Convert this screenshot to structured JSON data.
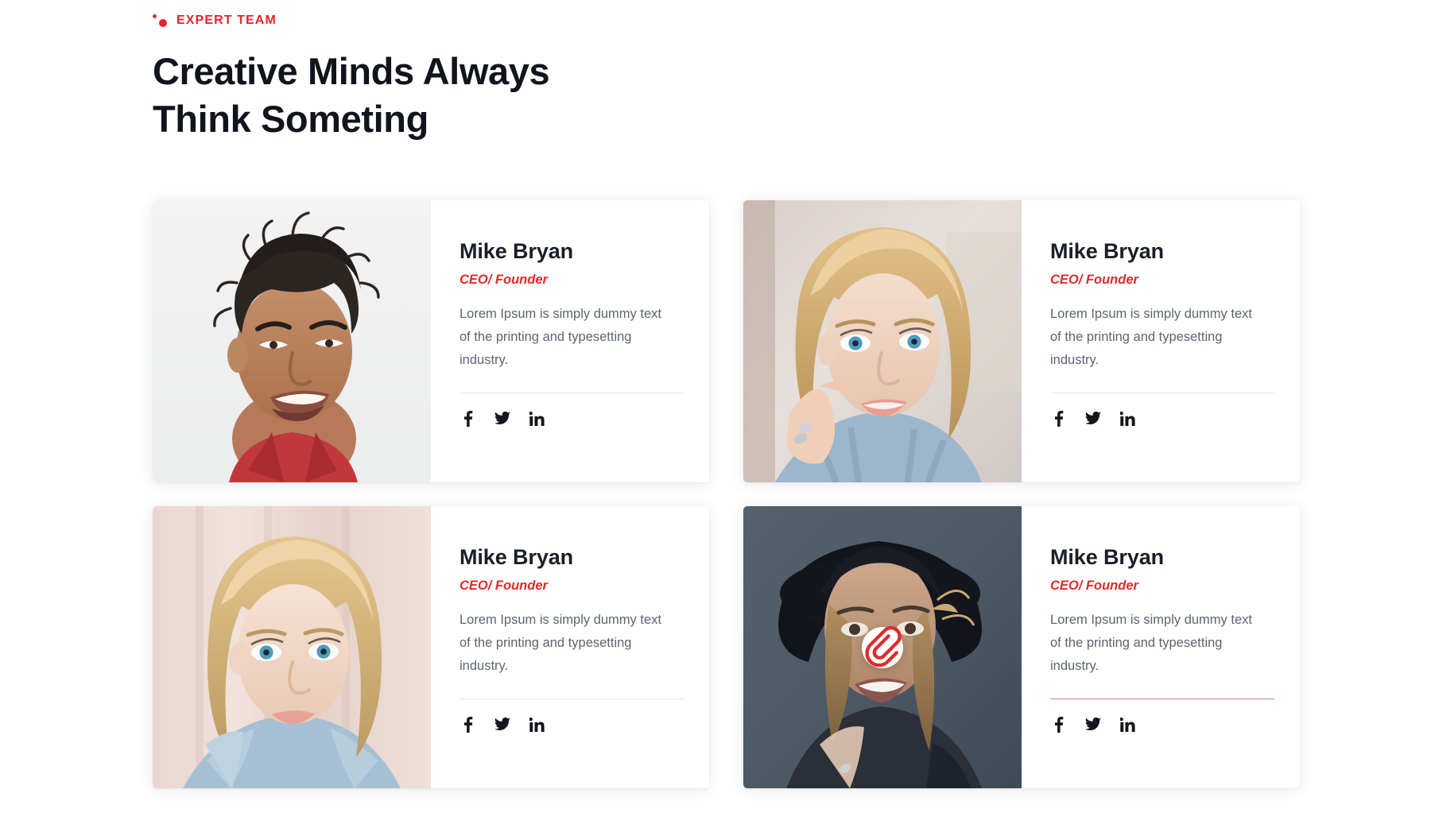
{
  "section": {
    "eyebrow": "EXPERT TEAM",
    "title_line1": "Creative Minds Always",
    "title_line2": "Think Someting",
    "accent_color": "#e8232a",
    "heading_color": "#12141d",
    "body_text_color": "#5d6470"
  },
  "icons": {
    "dot_small": "dot-icon",
    "dot_large": "dot-icon",
    "facebook": "facebook-icon",
    "twitter": "twitter-icon",
    "linkedin": "linkedin-icon",
    "paperclip": "paperclip-icon"
  },
  "social_labels": {
    "facebook": "Facebook",
    "twitter": "Twitter",
    "linkedin": "LinkedIn"
  },
  "cards": [
    {
      "name": "Mike Bryan",
      "role": "CEO/ Founder",
      "description": "Lorem Ipsum is simply dummy text of the printing and typesetting industry.",
      "photo_alt": "Smiling man with curly dark hair on light gray background",
      "divider_color": "#e8e8ec",
      "has_badge": false
    },
    {
      "name": "Mike Bryan",
      "role": "CEO/ Founder",
      "description": "Lorem Ipsum is simply dummy text of the printing and typesetting industry.",
      "photo_alt": "Blonde woman resting chin on hand looking upward",
      "divider_color": "#e8e8ec",
      "has_badge": false
    },
    {
      "name": "Mike Bryan",
      "role": "CEO/ Founder",
      "description": "Lorem Ipsum is simply dummy text of the printing and typesetting industry.",
      "photo_alt": "Blonde woman in blue hoodie against pink wall",
      "divider_color": "#e8e8ec",
      "has_badge": false
    },
    {
      "name": "Mike Bryan",
      "role": "CEO/ Founder",
      "description": "Lorem Ipsum is simply dummy text of the printing and typesetting industry.",
      "photo_alt": "Woman in black wide brim hat on dark blue gray background",
      "divider_color": "#e7777c",
      "has_badge": true
    }
  ]
}
